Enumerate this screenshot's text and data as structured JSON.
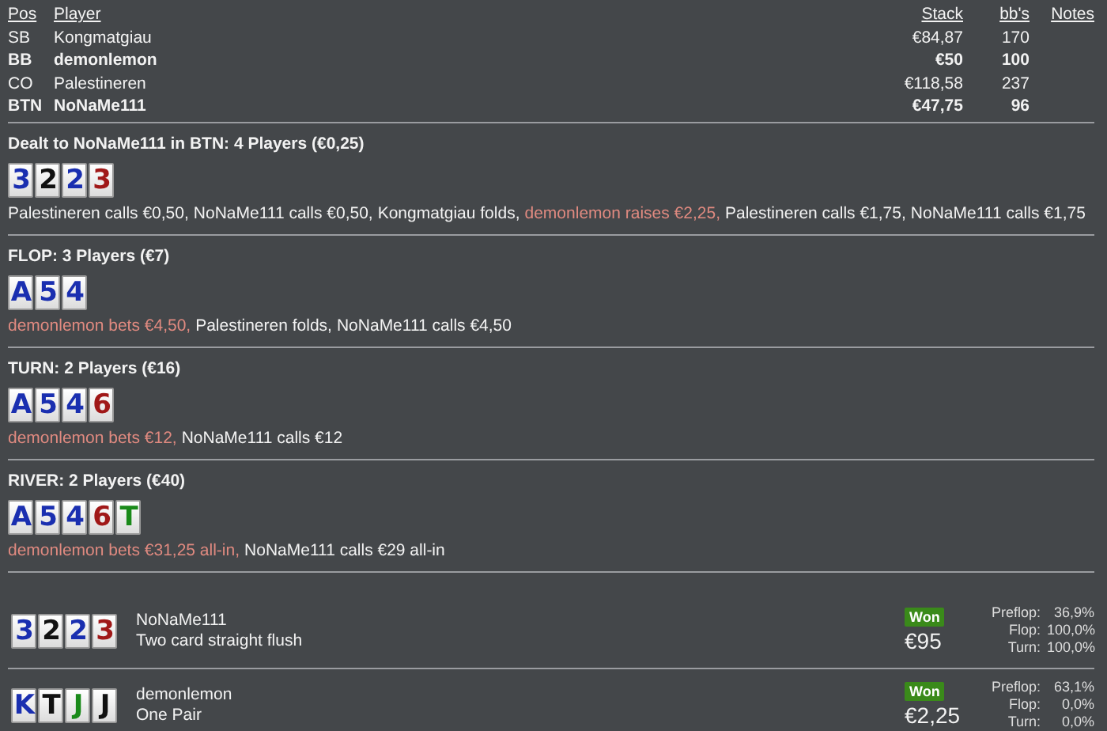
{
  "players": {
    "columns": [
      "Pos",
      "Player",
      "Stack",
      "bb's",
      "Notes"
    ],
    "rows": [
      {
        "pos": "SB",
        "player": "Kongmatgiau",
        "stack": "€84,87",
        "bbs": "170",
        "highlighted": false
      },
      {
        "pos": "BB",
        "player": "demonlemon",
        "stack": "€50",
        "bbs": "100",
        "highlighted": true
      },
      {
        "pos": "CO",
        "player": "Palestineren",
        "stack": "€118,58",
        "bbs": "237",
        "highlighted": false
      },
      {
        "pos": "BTN",
        "player": "NoNaMe111",
        "stack": "€47,75",
        "bbs": "96",
        "highlighted": true
      }
    ]
  },
  "streets": [
    {
      "title": "Dealt to NoNaMe111 in BTN: 4 Players (€0,25)",
      "cards": [
        {
          "rank": "3",
          "color": "#1a2fb0"
        },
        {
          "rank": "2",
          "color": "#111111"
        },
        {
          "rank": "2",
          "color": "#1a2fb0"
        },
        {
          "rank": "3",
          "color": "#a01818"
        }
      ],
      "actions": [
        {
          "text": "Palestineren calls €0,50,",
          "highlighted": false
        },
        {
          "text": "NoNaMe111 calls €0,50,",
          "highlighted": false
        },
        {
          "text": "Kongmatgiau folds,",
          "highlighted": false
        },
        {
          "text": "demonlemon raises €2,25,",
          "highlighted": true
        },
        {
          "text": "Palestineren calls €1,75,",
          "highlighted": false
        },
        {
          "text": "NoNaMe111 calls €1,75",
          "highlighted": false
        }
      ]
    },
    {
      "title": "FLOP: 3 Players (€7)",
      "cards": [
        {
          "rank": "A",
          "color": "#1a2fb0"
        },
        {
          "rank": "5",
          "color": "#1a2fb0"
        },
        {
          "rank": "4",
          "color": "#1a2fb0"
        }
      ],
      "actions": [
        {
          "text": "demonlemon bets €4,50,",
          "highlighted": true
        },
        {
          "text": "Palestineren folds,",
          "highlighted": false
        },
        {
          "text": "NoNaMe111 calls €4,50",
          "highlighted": false
        }
      ]
    },
    {
      "title": "TURN: 2 Players (€16)",
      "cards": [
        {
          "rank": "A",
          "color": "#1a2fb0"
        },
        {
          "rank": "5",
          "color": "#1a2fb0"
        },
        {
          "rank": "4",
          "color": "#1a2fb0"
        },
        {
          "rank": "6",
          "color": "#a01818"
        }
      ],
      "actions": [
        {
          "text": "demonlemon bets €12,",
          "highlighted": true
        },
        {
          "text": "NoNaMe111 calls €12",
          "highlighted": false
        }
      ]
    },
    {
      "title": "RIVER: 2 Players (€40)",
      "cards": [
        {
          "rank": "A",
          "color": "#1a2fb0"
        },
        {
          "rank": "5",
          "color": "#1a2fb0"
        },
        {
          "rank": "4",
          "color": "#1a2fb0"
        },
        {
          "rank": "6",
          "color": "#a01818"
        },
        {
          "rank": "T",
          "color": "#1a8a1a"
        }
      ],
      "actions": [
        {
          "text": "demonlemon bets €31,25 all-in,",
          "highlighted": true
        },
        {
          "text": "NoNaMe111 calls €29 all-in",
          "highlighted": false
        }
      ]
    }
  ],
  "results": [
    {
      "cards": [
        {
          "rank": "3",
          "color": "#1a2fb0"
        },
        {
          "rank": "2",
          "color": "#111111"
        },
        {
          "rank": "2",
          "color": "#1a2fb0"
        },
        {
          "rank": "3",
          "color": "#a01818"
        }
      ],
      "player": "NoNaMe111",
      "hand": "Two card straight flush",
      "badge": "Won",
      "amount": "€95",
      "equities": [
        {
          "label": "Preflop:",
          "value": "36,9%"
        },
        {
          "label": "Flop:",
          "value": "100,0%"
        },
        {
          "label": "Turn:",
          "value": "100,0%"
        }
      ]
    },
    {
      "cards": [
        {
          "rank": "K",
          "color": "#1a2fb0"
        },
        {
          "rank": "T",
          "color": "#111111"
        },
        {
          "rank": "J",
          "color": "#1a8a1a"
        },
        {
          "rank": "J",
          "color": "#111111"
        }
      ],
      "player": "demonlemon",
      "hand": "One Pair",
      "badge": "Won",
      "amount": "€2,25",
      "equities": [
        {
          "label": "Preflop:",
          "value": "63,1%"
        },
        {
          "label": "Flop:",
          "value": "0,0%"
        },
        {
          "label": "Turn:",
          "value": "0,0%"
        }
      ]
    }
  ]
}
